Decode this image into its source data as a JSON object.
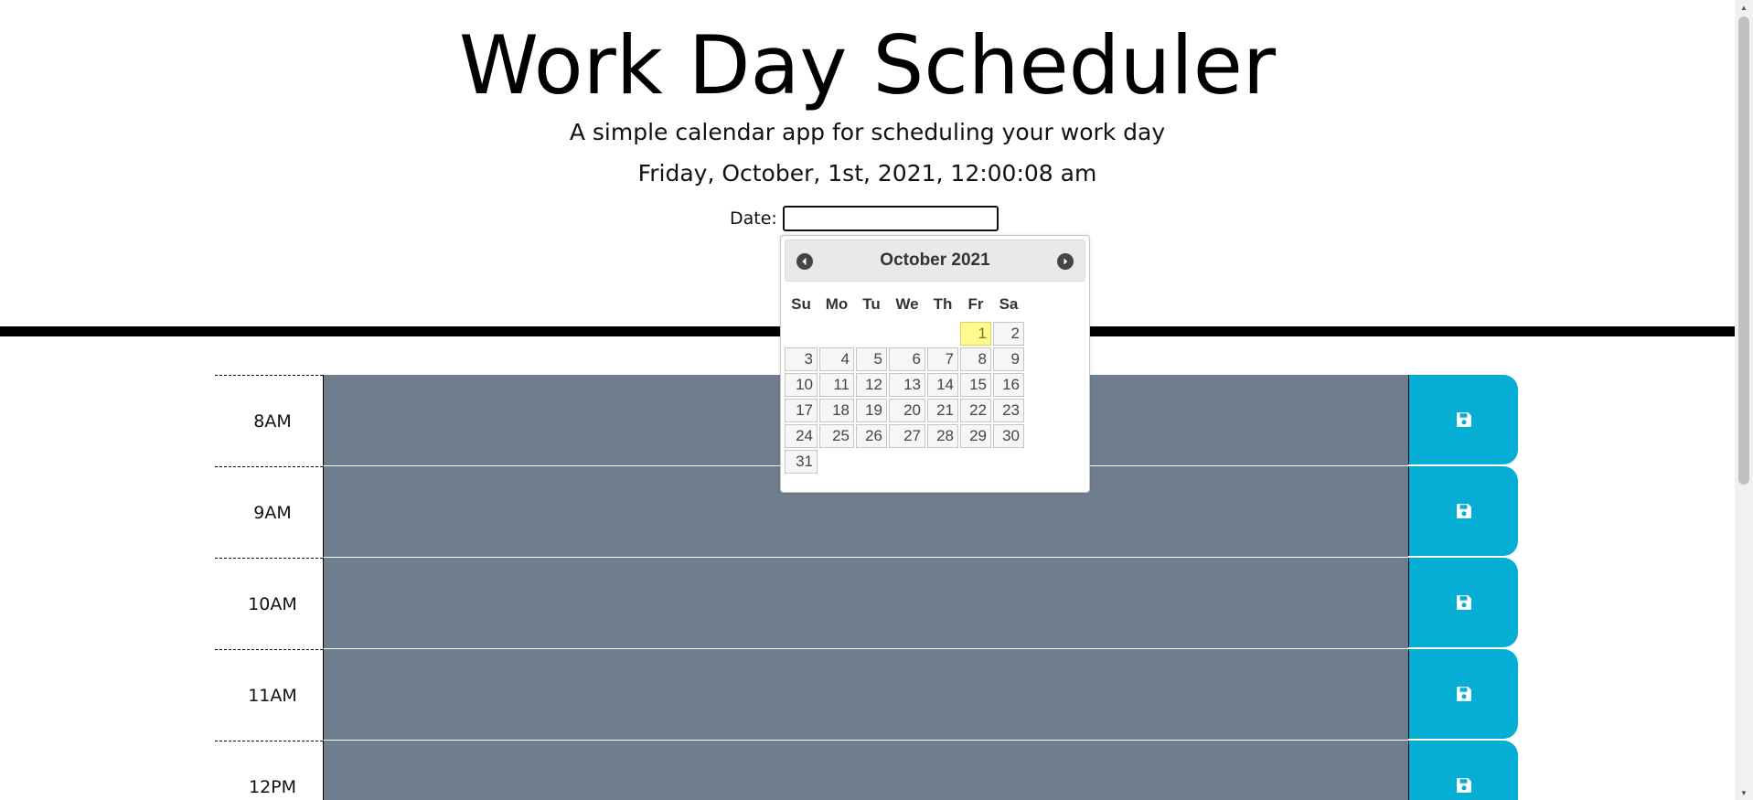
{
  "header": {
    "title": "Work Day Scheduler",
    "subtitle": "A simple calendar app for scheduling your work day",
    "current_datetime": "Friday, October, 1st, 2021, 12:00:08 am"
  },
  "date_picker_field": {
    "label": "Date:",
    "value": ""
  },
  "datepicker": {
    "month_title": "October 2021",
    "prev_icon": "chevron-left-circle-icon",
    "next_icon": "chevron-right-circle-icon",
    "weekdays": [
      "Su",
      "Mo",
      "Tu",
      "We",
      "Th",
      "Fr",
      "Sa"
    ],
    "weeks": [
      [
        "",
        "",
        "",
        "",
        "",
        "1",
        "2"
      ],
      [
        "3",
        "4",
        "5",
        "6",
        "7",
        "8",
        "9"
      ],
      [
        "10",
        "11",
        "12",
        "13",
        "14",
        "15",
        "16"
      ],
      [
        "17",
        "18",
        "19",
        "20",
        "21",
        "22",
        "23"
      ],
      [
        "24",
        "25",
        "26",
        "27",
        "28",
        "29",
        "30"
      ],
      [
        "31",
        "",
        "",
        "",
        "",
        "",
        ""
      ]
    ],
    "highlighted_day": "1"
  },
  "time_blocks": [
    {
      "hour": "8AM",
      "text": ""
    },
    {
      "hour": "9AM",
      "text": ""
    },
    {
      "hour": "10AM",
      "text": ""
    },
    {
      "hour": "11AM",
      "text": ""
    },
    {
      "hour": "12PM",
      "text": ""
    }
  ],
  "save_icon": "floppy-disk-icon",
  "colors": {
    "past_block": "#6f7e8e",
    "save_button": "#06aed5",
    "today_highlight": "#fffa90",
    "divider": "#000000"
  }
}
